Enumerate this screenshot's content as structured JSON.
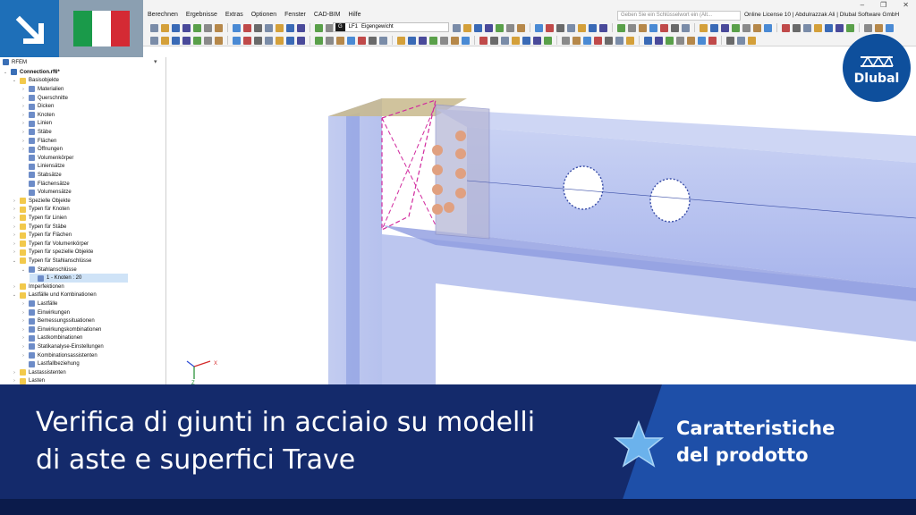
{
  "menu": [
    "Berechnen",
    "Ergebnisse",
    "Extras",
    "Optionen",
    "Fenster",
    "CAD-BIM",
    "Hilfe"
  ],
  "search": {
    "placeholder": "Geben Sie ein Schlüsselwort ein (Alt..."
  },
  "license": "Online License 10 | Abdulrazzak Ali | Dlubal Software GmbH",
  "loadcase": {
    "badge": "G",
    "id": "LF1",
    "name": "Eigengewicht"
  },
  "navigator": {
    "root": "RFEM",
    "items": [
      {
        "label": "Connection.rf6*",
        "level": 0,
        "expanded": true,
        "icon": "file-icon",
        "bold": true
      },
      {
        "label": "Basisobjekte",
        "level": 1,
        "expanded": true,
        "icon": "folder-icon"
      },
      {
        "label": "Materialien",
        "level": 2,
        "expanded": false,
        "icon": "materials-icon"
      },
      {
        "label": "Querschnitte",
        "level": 2,
        "expanded": false,
        "icon": "section-icon"
      },
      {
        "label": "Dicken",
        "level": 2,
        "expanded": false,
        "icon": "thickness-icon"
      },
      {
        "label": "Knoten",
        "level": 2,
        "expanded": false,
        "icon": "node-icon"
      },
      {
        "label": "Linien",
        "level": 2,
        "expanded": false,
        "icon": "line-icon"
      },
      {
        "label": "Stäbe",
        "level": 2,
        "expanded": false,
        "icon": "member-icon"
      },
      {
        "label": "Flächen",
        "level": 2,
        "expanded": false,
        "icon": "surface-icon"
      },
      {
        "label": "Öffnungen",
        "level": 2,
        "expanded": false,
        "icon": "opening-icon"
      },
      {
        "label": "Volumenkörper",
        "level": 2,
        "expanded": null,
        "icon": "solid-icon"
      },
      {
        "label": "Liniensätze",
        "level": 2,
        "expanded": null,
        "icon": "line-set-icon"
      },
      {
        "label": "Stabsätze",
        "level": 2,
        "expanded": null,
        "icon": "member-set-icon"
      },
      {
        "label": "Flächensätze",
        "level": 2,
        "expanded": null,
        "icon": "surface-set-icon"
      },
      {
        "label": "Volumensätze",
        "level": 2,
        "expanded": null,
        "icon": "solid-set-icon"
      },
      {
        "label": "Spezielle Objekte",
        "level": 1,
        "expanded": false,
        "icon": "folder-icon"
      },
      {
        "label": "Typen für Knoten",
        "level": 1,
        "expanded": false,
        "icon": "folder-icon"
      },
      {
        "label": "Typen für Linien",
        "level": 1,
        "expanded": false,
        "icon": "folder-icon"
      },
      {
        "label": "Typen für Stäbe",
        "level": 1,
        "expanded": false,
        "icon": "folder-icon"
      },
      {
        "label": "Typen für Flächen",
        "level": 1,
        "expanded": false,
        "icon": "folder-icon"
      },
      {
        "label": "Typen für Volumenkörper",
        "level": 1,
        "expanded": false,
        "icon": "folder-icon"
      },
      {
        "label": "Typen für spezielle Objekte",
        "level": 1,
        "expanded": false,
        "icon": "folder-icon"
      },
      {
        "label": "Typen für Stahlanschlüsse",
        "level": 1,
        "expanded": true,
        "icon": "folder-icon"
      },
      {
        "label": "Stahlanschlüsse",
        "level": 2,
        "expanded": true,
        "icon": "steel-joint-icon"
      },
      {
        "label": "1 - Knoten : 20",
        "level": 3,
        "expanded": null,
        "icon": "joint-item-icon",
        "selected": true
      },
      {
        "label": "Imperfektionen",
        "level": 1,
        "expanded": false,
        "icon": "folder-icon"
      },
      {
        "label": "Lastfälle und Kombinationen",
        "level": 1,
        "expanded": true,
        "icon": "folder-icon"
      },
      {
        "label": "Lastfälle",
        "level": 2,
        "expanded": false,
        "icon": "load-case-icon"
      },
      {
        "label": "Einwirkungen",
        "level": 2,
        "expanded": false,
        "icon": "action-icon"
      },
      {
        "label": "Bemessungssituationen",
        "level": 2,
        "expanded": false,
        "icon": "design-situation-icon"
      },
      {
        "label": "Einwirkungskombinationen",
        "level": 2,
        "expanded": false,
        "icon": "action-combination-icon"
      },
      {
        "label": "Lastkombinationen",
        "level": 2,
        "expanded": false,
        "icon": "load-combination-icon"
      },
      {
        "label": "Statikanalyse-Einstellungen",
        "level": 2,
        "expanded": false,
        "icon": "analysis-settings-icon"
      },
      {
        "label": "Kombinationsassistenten",
        "level": 2,
        "expanded": false,
        "icon": "wizard-icon"
      },
      {
        "label": "Lastfallbeziehung",
        "level": 2,
        "expanded": null,
        "icon": "relation-icon"
      },
      {
        "label": "Lastassistenten",
        "level": 1,
        "expanded": false,
        "icon": "folder-icon"
      },
      {
        "label": "Lasten",
        "level": 1,
        "expanded": false,
        "icon": "folder-icon"
      }
    ]
  },
  "axes": {
    "x": "X",
    "z": "Z"
  },
  "flag": {
    "colors": [
      "#1a9a4a",
      "#ffffff",
      "#d42a34"
    ]
  },
  "colors": {
    "banner_dark": "#142a6b",
    "banner_light": "#1e4fa8",
    "brand": "#0e4f9c",
    "accent_star": "#6bb2ec"
  },
  "logo": {
    "text": "Dlubal"
  },
  "banner": {
    "headline_line1": "Verifica di giunti in acciaio su modelli",
    "headline_line2": "di aste e superfici Trave",
    "category_line1": "Caratteristiche",
    "category_line2": "del prodotto"
  }
}
